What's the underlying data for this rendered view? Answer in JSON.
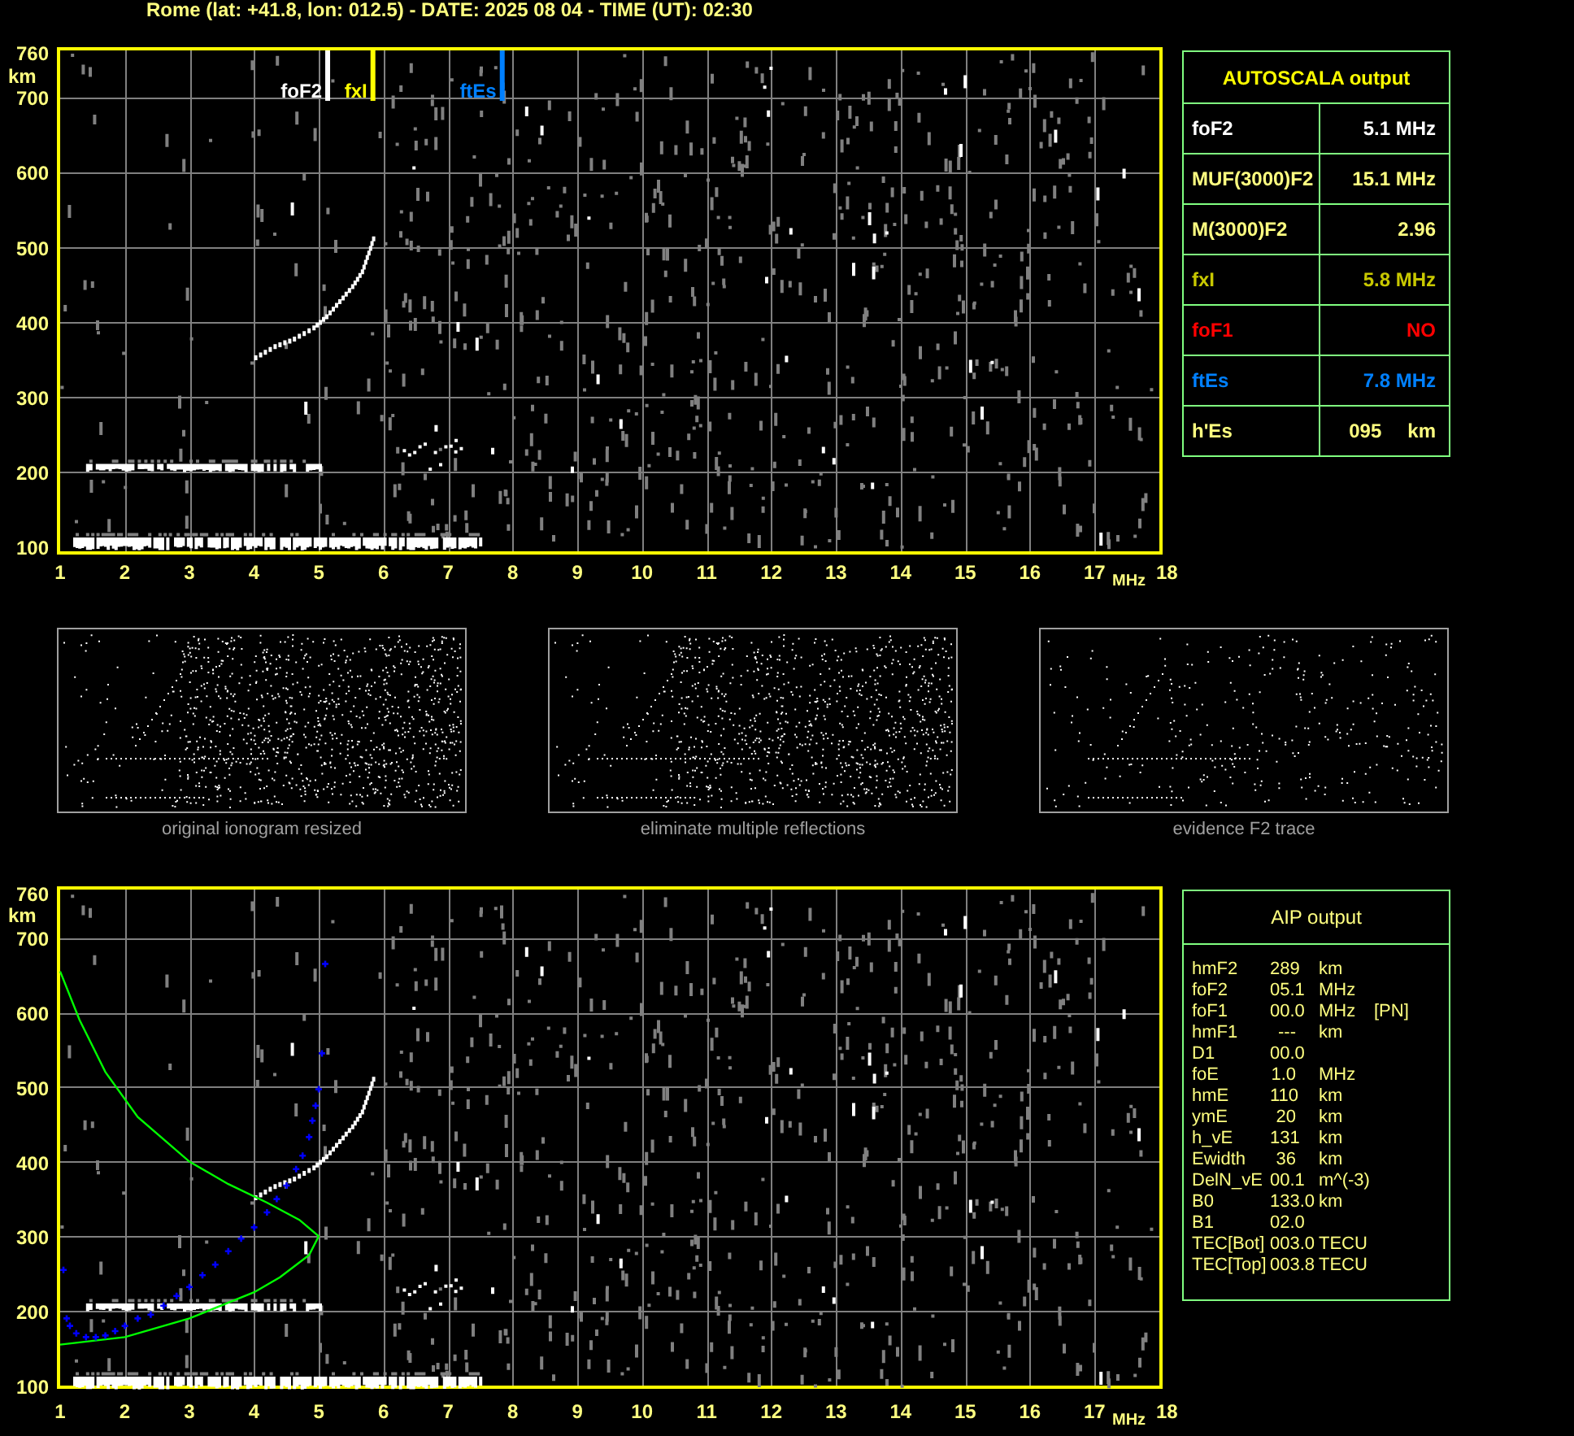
{
  "header": "Rome (lat: +41.8, lon: 012.5) - DATE: 2025 08 04 - TIME (UT): 02:30",
  "ionogram": {
    "y_unit": "km",
    "x_unit": "MHz",
    "y_ticks": [
      "760",
      "700",
      "600",
      "500",
      "400",
      "300",
      "200",
      "100"
    ],
    "x_ticks": [
      "1",
      "2",
      "3",
      "4",
      "5",
      "6",
      "7",
      "8",
      "9",
      "10",
      "11",
      "12",
      "13",
      "14",
      "15",
      "16",
      "17",
      "18"
    ],
    "markers": [
      {
        "label": "foF2",
        "color": "#ffffff"
      },
      {
        "label": "fxI",
        "color": "#ffff00"
      },
      {
        "label": "ftEs",
        "color": "#0080ff"
      }
    ]
  },
  "autoscala": {
    "title": "AUTOSCALA output",
    "rows": [
      {
        "name": "foF2",
        "value": "5.1 MHz",
        "color": "#ffffff"
      },
      {
        "name": "MUF(3000)F2",
        "value": "15.1 MHz",
        "color": "#ffff80"
      },
      {
        "name": "M(3000)F2",
        "value": "2.96",
        "color": "#ffff80"
      },
      {
        "name": "fxI",
        "value": "5.8 MHz",
        "color": "#c8c800"
      },
      {
        "name": "foF1",
        "value": "NO",
        "color": "#ff0000"
      },
      {
        "name": "ftEs",
        "value": "7.8 MHz",
        "color": "#0080ff"
      },
      {
        "name": "h'Es",
        "value": "095",
        "unit": "km",
        "color": "#ffff80"
      }
    ]
  },
  "thumbnails": [
    {
      "caption": "original ionogram resized"
    },
    {
      "caption": "eliminate multiple reflections"
    },
    {
      "caption": "evidence F2 trace"
    }
  ],
  "aip_ionogram": {
    "y_unit": "km",
    "x_unit": "MHz",
    "y_ticks": [
      "760",
      "700",
      "600",
      "500",
      "400",
      "300",
      "200",
      "100"
    ],
    "x_ticks": [
      "1",
      "2",
      "3",
      "4",
      "5",
      "6",
      "7",
      "8",
      "9",
      "10",
      "11",
      "12",
      "13",
      "14",
      "15",
      "16",
      "17",
      "18"
    ]
  },
  "aip": {
    "title": "AIP output",
    "rows": [
      {
        "name": "hmF2",
        "value": "289",
        "unit": "km"
      },
      {
        "name": "foF2",
        "value": "05.1",
        "unit": "MHz"
      },
      {
        "name": "foF1",
        "value": "00.0",
        "unit": "MHz",
        "note": "[PN]"
      },
      {
        "name": "hmF1",
        "value": "---",
        "unit": "km"
      },
      {
        "name": "D1",
        "value": "00.0"
      },
      {
        "name": "foE",
        "value": "1.0",
        "unit": "MHz"
      },
      {
        "name": "hmE",
        "value": "110",
        "unit": "km"
      },
      {
        "name": "ymE",
        "value": "20",
        "unit": "km"
      },
      {
        "name": "h_vE",
        "value": "131",
        "unit": "km"
      },
      {
        "name": "Ewidth",
        "value": "36",
        "unit": "km"
      },
      {
        "name": "DelN_vE",
        "value": "00.1",
        "unit": "m^(-3)"
      },
      {
        "name": "B0",
        "value": "133.0",
        "unit": "km"
      },
      {
        "name": "B1",
        "value": "02.0"
      },
      {
        "name": "TEC[Bot]",
        "value": "003.0",
        "unit": "TECU"
      },
      {
        "name": "TEC[Top]",
        "value": "003.8",
        "unit": "TECU"
      }
    ]
  }
}
